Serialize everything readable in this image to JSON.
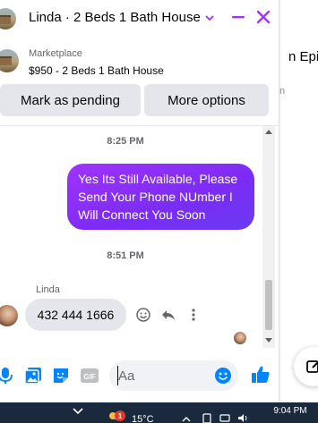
{
  "background_page": {
    "title_fragment": "n Epic",
    "subtitle_fragment": "n"
  },
  "chat": {
    "title": "Linda · 2 Beds 1 Bath House",
    "listing": {
      "source": "Marketplace",
      "title": "$950 - 2 Beds 1 Bath House"
    },
    "actions": {
      "mark_pending": "Mark as pending",
      "more_options": "More options"
    },
    "messages": [
      {
        "type": "timestamp",
        "text": "8:25 PM"
      },
      {
        "type": "outgoing",
        "text": "Yes Its Still Available, Please Send Your Phone NUmber I Will Connect You Soon"
      },
      {
        "type": "timestamp",
        "text": "8:51 PM"
      },
      {
        "type": "incoming",
        "sender": "Linda",
        "text": "432 444 1666"
      }
    ],
    "composer": {
      "placeholder": "Aa"
    }
  },
  "taskbar": {
    "notification_count": "1",
    "temperature": "15°C",
    "time": "9:04 PM"
  },
  "colors": {
    "messenger_accent": "#a033ff",
    "outgoing_bubble": "#7a2cf5",
    "composer_icon_blue": "#0084ff",
    "incoming_bubble": "#e4e6eb",
    "taskbar": "#1a2a3c"
  }
}
